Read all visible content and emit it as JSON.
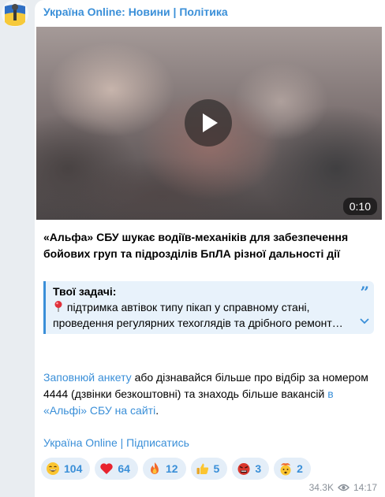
{
  "channel": {
    "name": "Україна Online: Новини | Політика"
  },
  "video": {
    "duration": "0:10"
  },
  "post": {
    "headline": "«Альфа» СБУ шукає водіїв-механіків для забезпечення бойових груп та підрозділів БпЛА різної дальності дії",
    "quote": {
      "title": "Твої задачі:",
      "line1": "підтримка автівок типу пікап у справному стані,",
      "line2": "проведення регулярних техоглядів та дрібного ремонт…"
    },
    "body": {
      "link1": "Заповнюй анкету",
      "text1": " або дізнавайся більше про відбір за номером 4444 (дзвінки безкоштовні) та знаходь більше вакансій ",
      "link2": "в «Альфі» СБУ на сайті",
      "text2": "."
    },
    "signature": "Україна Online | Підписатись"
  },
  "reactions": [
    {
      "icon": "grin-emoji-icon",
      "count": "104"
    },
    {
      "icon": "red-heart-icon",
      "count": "64"
    },
    {
      "icon": "fire-icon",
      "count": "12"
    },
    {
      "icon": "thumbs-up-icon",
      "count": "5"
    },
    {
      "icon": "angry-face-icon",
      "count": "3"
    },
    {
      "icon": "mind-blown-icon",
      "count": "2"
    }
  ],
  "meta": {
    "views": "34.3K",
    "time": "14:17"
  },
  "colors": {
    "accent": "#3a8fd8",
    "background": "#e9edf1",
    "quote_bg": "#e8f2fb",
    "reaction_bg": "#e4eef8"
  }
}
